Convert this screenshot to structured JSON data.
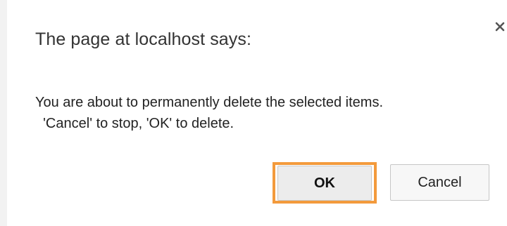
{
  "dialog": {
    "title": "The page at localhost says:",
    "close_icon": "close-icon",
    "message_line1": "You are about to permanently delete the selected items.",
    "message_line2": "  'Cancel' to stop, 'OK' to delete.",
    "ok_label": "OK",
    "cancel_label": "Cancel"
  },
  "colors": {
    "focus_ring": "#f39a3c",
    "ok_background": "#ececec",
    "cancel_background": "#f7f7f7",
    "text": "#333333"
  }
}
